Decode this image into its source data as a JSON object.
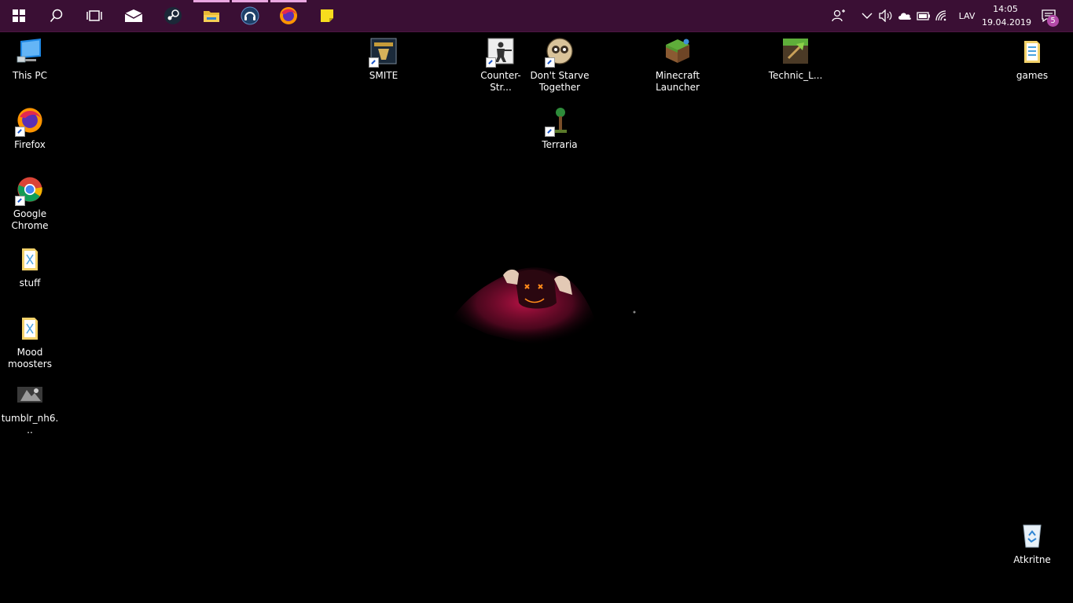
{
  "taskbar": {
    "pinned": [
      {
        "name": "start",
        "icon": "windows-logo-icon"
      },
      {
        "name": "search",
        "icon": "search-icon"
      },
      {
        "name": "task-view",
        "icon": "task-view-icon"
      },
      {
        "name": "mail",
        "icon": "mail-icon"
      },
      {
        "name": "steam",
        "icon": "steam-icon"
      },
      {
        "name": "file-explorer",
        "icon": "folder-icon"
      },
      {
        "name": "teamspeak",
        "icon": "headset-icon"
      },
      {
        "name": "firefox",
        "icon": "firefox-icon"
      },
      {
        "name": "sticky-notes",
        "icon": "sticky-note-icon"
      }
    ],
    "tray": {
      "language": "LAV",
      "time": "14:05",
      "date": "19.04.2019",
      "notification_count": "5"
    },
    "colors": {
      "background": "#3a0f34",
      "running_indicator": "#e9a7e0",
      "badge": "#b34aa8"
    }
  },
  "desktop": {
    "icons": [
      {
        "id": "this-pc",
        "label": "This PC"
      },
      {
        "id": "firefox",
        "label": "Firefox"
      },
      {
        "id": "google-chrome",
        "label": "Google Chrome"
      },
      {
        "id": "stuff",
        "label": "stuff"
      },
      {
        "id": "mood-moosters",
        "label": "Mood moosters"
      },
      {
        "id": "tumblr",
        "label": "tumblr_nh6..."
      },
      {
        "id": "smite",
        "label": "SMITE"
      },
      {
        "id": "counter-strike",
        "label": "Counter-Str..."
      },
      {
        "id": "dont-starve-together",
        "label": "Don't Starve Together"
      },
      {
        "id": "minecraft-launcher",
        "label": "Minecraft Launcher"
      },
      {
        "id": "technic-launcher",
        "label": "Technic_L..."
      },
      {
        "id": "terraria",
        "label": "Terraria"
      },
      {
        "id": "games",
        "label": "games"
      },
      {
        "id": "recycle-bin",
        "label": "Atkritne"
      }
    ]
  }
}
